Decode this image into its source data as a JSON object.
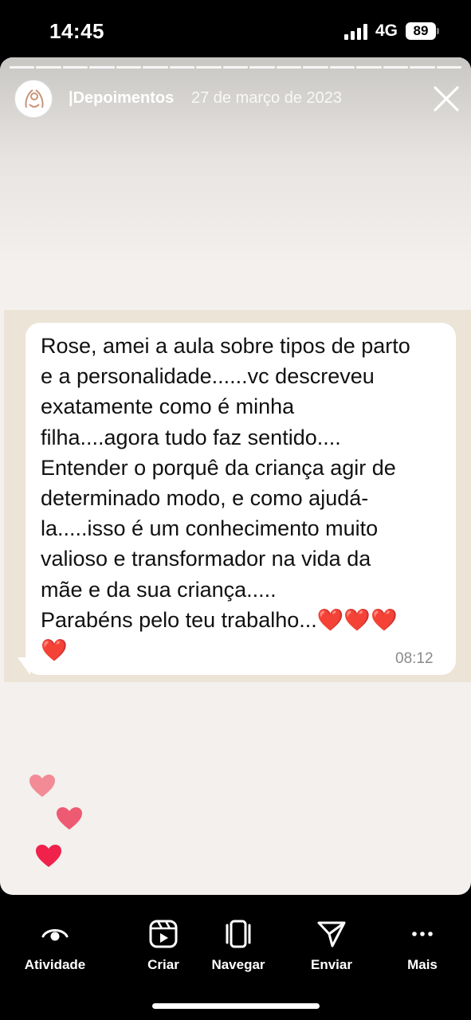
{
  "status_bar": {
    "time": "14:45",
    "network": "4G",
    "battery": "89"
  },
  "story": {
    "account_name": "|Depoimentos",
    "date": "27 de março de 2023",
    "segments": 17
  },
  "message": {
    "text": "Rose, amei a aula sobre tipos de parto\ne a personalidade......vc descreveu\nexatamente como é minha\nfilha....agora tudo faz sentido....\nEntender o porquê da criança agir de\ndeterminado modo, e como ajudá-\nla.....isso é um conhecimento muito\nvalioso e transformador na vida da\nmãe e da sua criança.....\nParabéns pelo teu trabalho...❤️❤️❤️\n❤️",
    "time": "08:12"
  },
  "bottom_nav": {
    "items": [
      {
        "label": "Atividade",
        "icon": "activity-eye-icon"
      },
      {
        "label": "Criar",
        "icon": "reels-icon"
      },
      {
        "label": "Navegar",
        "icon": "browse-carousel-icon"
      },
      {
        "label": "Enviar",
        "icon": "send-paper-plane-icon"
      },
      {
        "label": "Mais",
        "icon": "more-dots-icon"
      }
    ]
  },
  "colors": {
    "heart_light": "#f28b96",
    "heart_mid": "#ee5a72",
    "heart_dark": "#f0224b"
  }
}
